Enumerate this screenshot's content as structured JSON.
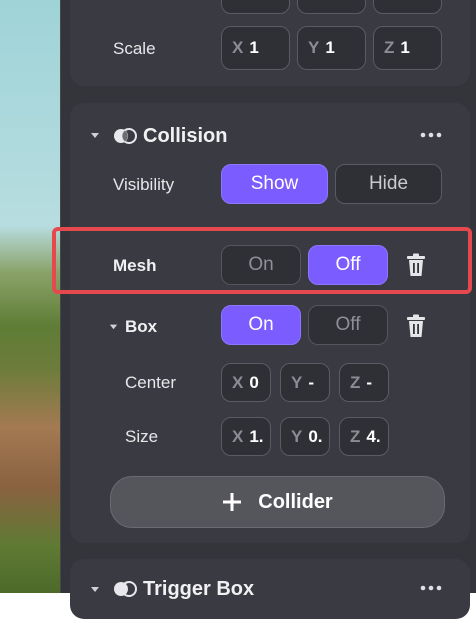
{
  "transform": {
    "scale_label": "Scale",
    "scale": {
      "x_axis": "X",
      "x": "1",
      "y_axis": "Y",
      "y": "1",
      "z_axis": "Z",
      "z": "1"
    }
  },
  "collision": {
    "title": "Collision",
    "visibility_label": "Visibility",
    "show_label": "Show",
    "hide_label": "Hide",
    "mesh_label": "Mesh",
    "mesh_on_label": "On",
    "mesh_off_label": "Off",
    "box_label": "Box",
    "box_on_label": "On",
    "box_off_label": "Off",
    "center_label": "Center",
    "center": {
      "x_axis": "X",
      "x": "0",
      "y_axis": "Y",
      "y": "-",
      "z_axis": "Z",
      "z": "-"
    },
    "size_label": "Size",
    "size": {
      "x_axis": "X",
      "x": "1.",
      "y_axis": "Y",
      "y": "0.",
      "z_axis": "Z",
      "z": "4."
    },
    "add_collider_label": "Collider"
  },
  "trigger_box": {
    "title": "Trigger Box"
  },
  "colors": {
    "accent": "#7a5cff",
    "highlight": "#e5484d",
    "panel": "#34353b"
  }
}
